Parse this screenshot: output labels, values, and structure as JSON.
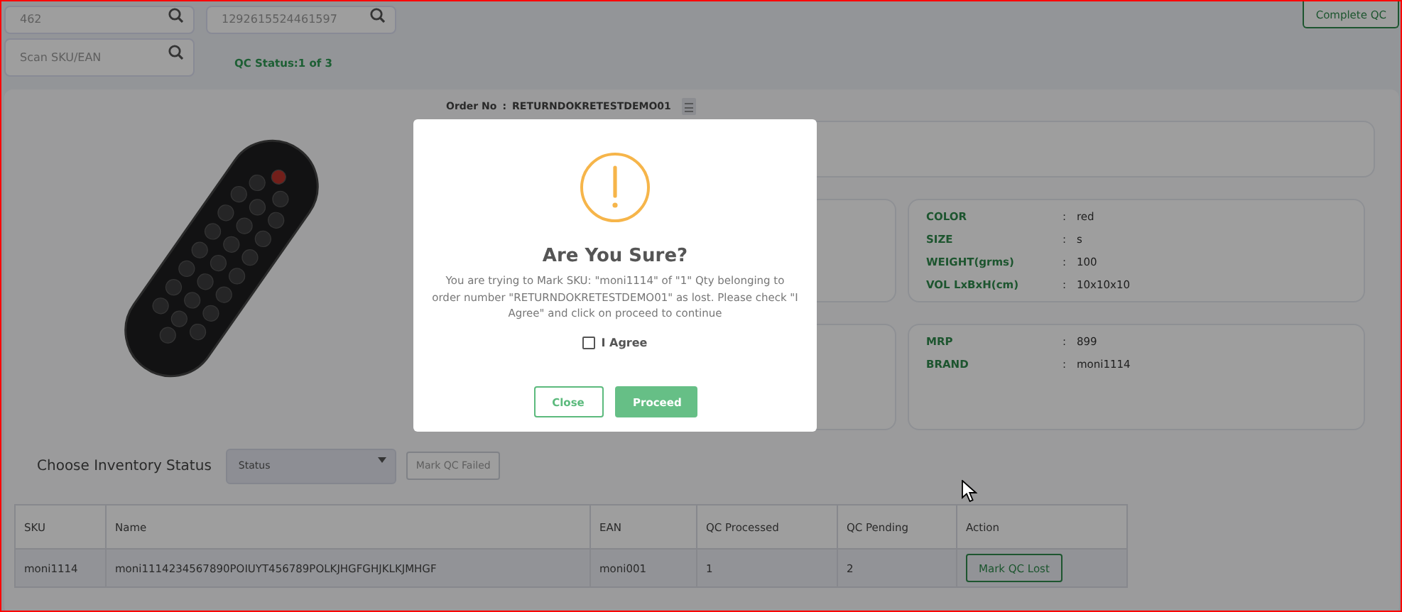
{
  "top_fields": [
    {
      "placeholder": "462"
    },
    {
      "placeholder": "1292615524461597"
    }
  ],
  "complete_qc_button": "Complete QC",
  "scan_field": {
    "placeholder": "Scan SKU/EAN"
  },
  "qc_status": "QC Status:1 of 3",
  "order": {
    "label": "Order No",
    "separator": ":",
    "value": "RETURNDOKRETESTDEMO01"
  },
  "attribute_panels": [
    {
      "rows": [
        {
          "label": "COLOR",
          "separator": ":",
          "value": "red"
        },
        {
          "label": "SIZE",
          "separator": ":",
          "value": "s"
        },
        {
          "label": "WEIGHT(grms)",
          "separator": ":",
          "value": "100"
        },
        {
          "label": "VOL LxBxH(cm)",
          "separator": ":",
          "value": "10x10x10"
        }
      ]
    },
    {
      "rows": [
        {
          "label": "MRP",
          "separator": ":",
          "value": "899"
        },
        {
          "label": "BRAND",
          "separator": ":",
          "value": "moni1114"
        }
      ]
    }
  ],
  "inventory_status": {
    "label": "Choose Inventory Status",
    "select_placeholder": "Status",
    "button": "Mark QC Failed"
  },
  "table": {
    "columns": [
      "SKU",
      "Name",
      "EAN",
      "QC Processed",
      "QC Pending",
      "Action"
    ],
    "rows": [
      {
        "cells": [
          "moni1114",
          "moni1114234567890POIUYT456789POLKJHGFGHJKLKJMHGF",
          "moni001",
          "1",
          "2"
        ],
        "action": "Mark QC Lost"
      }
    ]
  },
  "modal": {
    "title": "Are You Sure?",
    "message": "You are trying to Mark SKU: \"moni1114\" of \"1\" Qty belonging to order number \"RETURNDOKRETESTDEMO01\" as lost. Please check \"I Agree\" and click on proceed to continue",
    "checkbox": {
      "label": "I Agree",
      "checked": false
    },
    "buttons": [
      {
        "label": "Close",
        "kind": "outline"
      },
      {
        "label": "Proceed",
        "kind": "primary"
      }
    ]
  }
}
